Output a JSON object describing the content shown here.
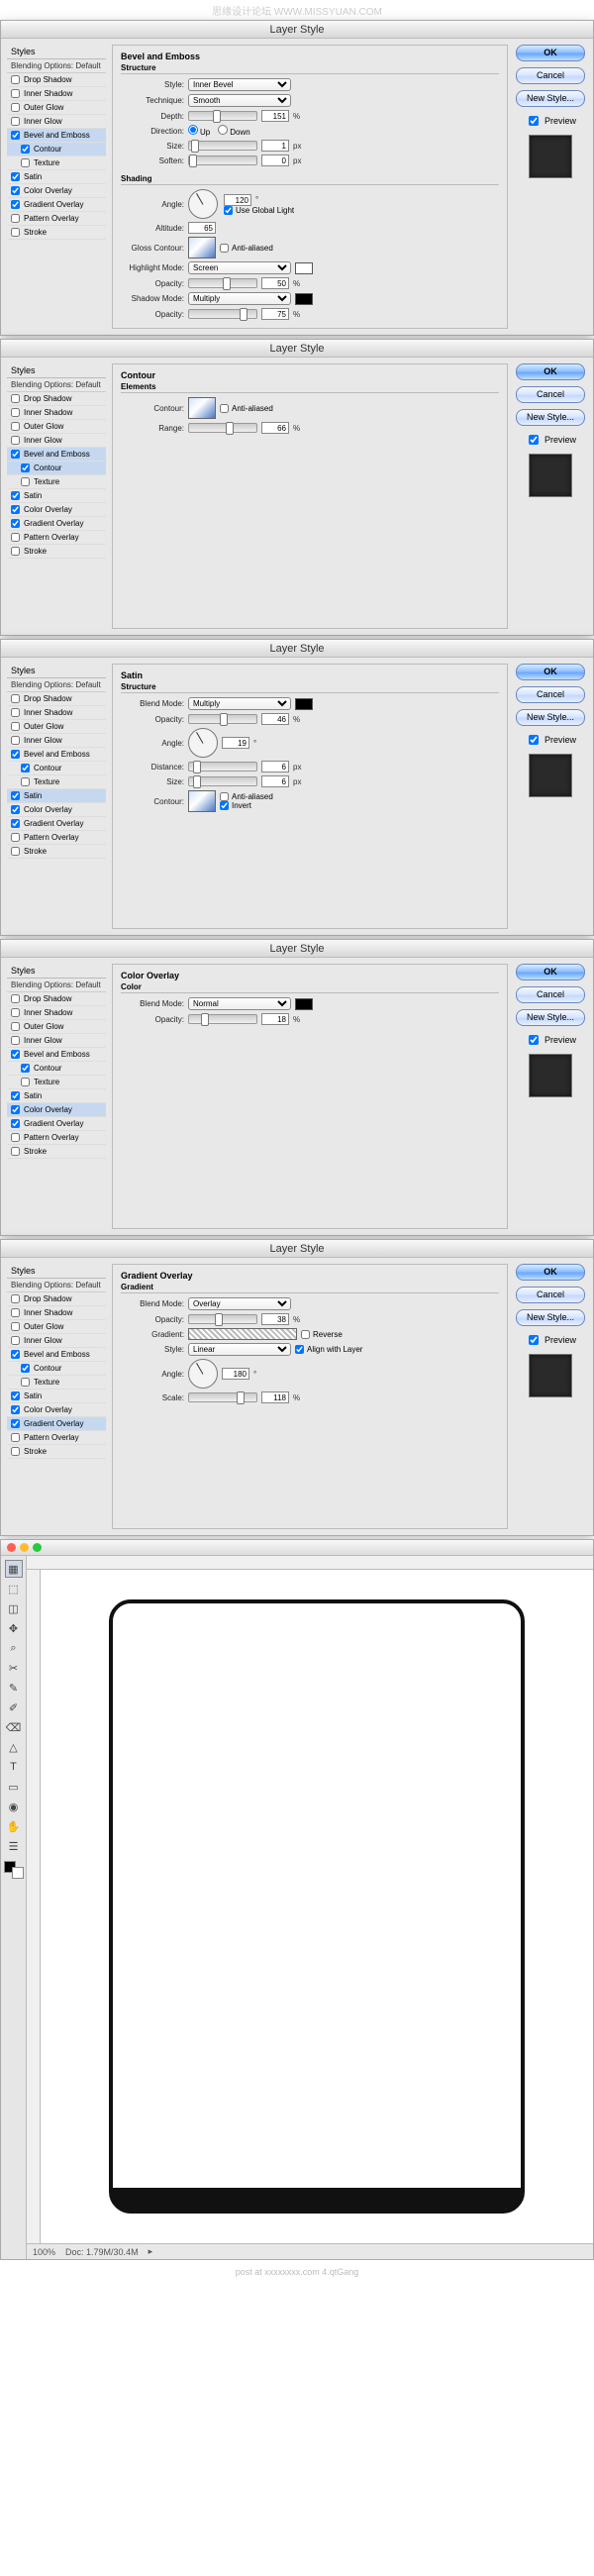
{
  "watermark": "思缘设计论坛  WWW.MISSYUAN.COM",
  "dialogs": [
    {
      "title": "Layer Style",
      "selected": "Bevel and Emboss",
      "sub_selected": "Contour",
      "styles": {
        "head": "Styles",
        "sub": "Blending Options: Default",
        "items": [
          {
            "label": "Drop Shadow",
            "ck": false,
            "indent": false
          },
          {
            "label": "Inner Shadow",
            "ck": false,
            "indent": false
          },
          {
            "label": "Outer Glow",
            "ck": false,
            "indent": false
          },
          {
            "label": "Inner Glow",
            "ck": false,
            "indent": false
          },
          {
            "label": "Bevel and Emboss",
            "ck": true,
            "indent": false,
            "sel": true
          },
          {
            "label": "Contour",
            "ck": true,
            "indent": true,
            "sel_light": true
          },
          {
            "label": "Texture",
            "ck": false,
            "indent": true
          },
          {
            "label": "Satin",
            "ck": true,
            "indent": false
          },
          {
            "label": "Color Overlay",
            "ck": true,
            "indent": false
          },
          {
            "label": "Gradient Overlay",
            "ck": true,
            "indent": false
          },
          {
            "label": "Pattern Overlay",
            "ck": false,
            "indent": false
          },
          {
            "label": "Stroke",
            "ck": false,
            "indent": false
          }
        ]
      },
      "panel": {
        "type": "bevel",
        "head": "Bevel and Emboss",
        "structure": "Structure",
        "style_l": "Style:",
        "style_v": "Inner Bevel",
        "tech_l": "Technique:",
        "tech_v": "Smooth",
        "depth_l": "Depth:",
        "depth_v": "151",
        "depth_u": "%",
        "dir_l": "Direction:",
        "dir_up": "Up",
        "dir_dn": "Down",
        "size_l": "Size:",
        "size_v": "1",
        "size_u": "px",
        "soften_l": "Soften:",
        "soften_v": "0",
        "soften_u": "px",
        "shading": "Shading",
        "ang_l": "Angle:",
        "ang_v": "120",
        "glob_l": "Use Global Light",
        "alt_l": "Altitude:",
        "alt_v": "65",
        "gc_l": "Gloss Contour:",
        "aa_l": "Anti-aliased",
        "hm_l": "Highlight Mode:",
        "hm_v": "Screen",
        "op_l": "Opacity:",
        "op1_v": "50",
        "op_u": "%",
        "sm_l": "Shadow Mode:",
        "sm_v": "Multiply",
        "op2_v": "75"
      },
      "ok": "OK",
      "cancel": "Cancel",
      "new": "New Style...",
      "preview": "Preview"
    },
    {
      "title": "Layer Style",
      "selected": "Contour",
      "styles": {
        "head": "Styles",
        "sub": "Blending Options: Default",
        "items": [
          {
            "label": "Drop Shadow",
            "ck": false
          },
          {
            "label": "Inner Shadow",
            "ck": false
          },
          {
            "label": "Outer Glow",
            "ck": false
          },
          {
            "label": "Inner Glow",
            "ck": false
          },
          {
            "label": "Bevel and Emboss",
            "ck": true,
            "sel_light": true
          },
          {
            "label": "Contour",
            "ck": true,
            "indent": true,
            "sel": true
          },
          {
            "label": "Texture",
            "ck": false,
            "indent": true
          },
          {
            "label": "Satin",
            "ck": true
          },
          {
            "label": "Color Overlay",
            "ck": true
          },
          {
            "label": "Gradient Overlay",
            "ck": true
          },
          {
            "label": "Pattern Overlay",
            "ck": false
          },
          {
            "label": "Stroke",
            "ck": false
          }
        ]
      },
      "panel": {
        "type": "contour",
        "head": "Contour",
        "elements": "Elements",
        "cont_l": "Contour:",
        "aa_l": "Anti-aliased",
        "range_l": "Range:",
        "range_v": "66",
        "range_u": "%"
      },
      "ok": "OK",
      "cancel": "Cancel",
      "new": "New Style...",
      "preview": "Preview"
    },
    {
      "title": "Layer Style",
      "selected": "Satin",
      "styles": {
        "head": "Styles",
        "sub": "Blending Options: Default",
        "items": [
          {
            "label": "Drop Shadow",
            "ck": false
          },
          {
            "label": "Inner Shadow",
            "ck": false
          },
          {
            "label": "Outer Glow",
            "ck": false
          },
          {
            "label": "Inner Glow",
            "ck": false
          },
          {
            "label": "Bevel and Emboss",
            "ck": true
          },
          {
            "label": "Contour",
            "ck": true,
            "indent": true
          },
          {
            "label": "Texture",
            "ck": false,
            "indent": true
          },
          {
            "label": "Satin",
            "ck": true,
            "sel": true
          },
          {
            "label": "Color Overlay",
            "ck": true
          },
          {
            "label": "Gradient Overlay",
            "ck": true
          },
          {
            "label": "Pattern Overlay",
            "ck": false
          },
          {
            "label": "Stroke",
            "ck": false
          }
        ]
      },
      "panel": {
        "type": "satin",
        "head": "Satin",
        "structure": "Structure",
        "bm_l": "Blend Mode:",
        "bm_v": "Multiply",
        "op_l": "Opacity:",
        "op_v": "46",
        "op_u": "%",
        "ang_l": "Angle:",
        "ang_v": "19",
        "dist_l": "Distance:",
        "dist_v": "6",
        "dist_u": "px",
        "size_l": "Size:",
        "size_v": "6",
        "size_u": "px",
        "cont_l": "Contour:",
        "aa_l": "Anti-aliased",
        "inv_l": "Invert"
      },
      "ok": "OK",
      "cancel": "Cancel",
      "new": "New Style...",
      "preview": "Preview"
    },
    {
      "title": "Layer Style",
      "selected": "Color Overlay",
      "styles": {
        "head": "Styles",
        "sub": "Blending Options: Default",
        "items": [
          {
            "label": "Drop Shadow",
            "ck": false
          },
          {
            "label": "Inner Shadow",
            "ck": false
          },
          {
            "label": "Outer Glow",
            "ck": false
          },
          {
            "label": "Inner Glow",
            "ck": false
          },
          {
            "label": "Bevel and Emboss",
            "ck": true
          },
          {
            "label": "Contour",
            "ck": true,
            "indent": true
          },
          {
            "label": "Texture",
            "ck": false,
            "indent": true
          },
          {
            "label": "Satin",
            "ck": true
          },
          {
            "label": "Color Overlay",
            "ck": true,
            "sel": true
          },
          {
            "label": "Gradient Overlay",
            "ck": true
          },
          {
            "label": "Pattern Overlay",
            "ck": false
          },
          {
            "label": "Stroke",
            "ck": false
          }
        ]
      },
      "panel": {
        "type": "coloroverlay",
        "head": "Color Overlay",
        "color": "Color",
        "bm_l": "Blend Mode:",
        "bm_v": "Normal",
        "op_l": "Opacity:",
        "op_v": "18",
        "op_u": "%"
      },
      "ok": "OK",
      "cancel": "Cancel",
      "new": "New Style...",
      "preview": "Preview"
    },
    {
      "title": "Layer Style",
      "selected": "Gradient Overlay",
      "styles": {
        "head": "Styles",
        "sub": "Blending Options: Default",
        "items": [
          {
            "label": "Drop Shadow",
            "ck": false
          },
          {
            "label": "Inner Shadow",
            "ck": false
          },
          {
            "label": "Outer Glow",
            "ck": false
          },
          {
            "label": "Inner Glow",
            "ck": false
          },
          {
            "label": "Bevel and Emboss",
            "ck": true
          },
          {
            "label": "Contour",
            "ck": true,
            "indent": true
          },
          {
            "label": "Texture",
            "ck": false,
            "indent": true
          },
          {
            "label": "Satin",
            "ck": true
          },
          {
            "label": "Color Overlay",
            "ck": true
          },
          {
            "label": "Gradient Overlay",
            "ck": true,
            "sel": true
          },
          {
            "label": "Pattern Overlay",
            "ck": false
          },
          {
            "label": "Stroke",
            "ck": false
          }
        ]
      },
      "panel": {
        "type": "gradientoverlay",
        "head": "Gradient Overlay",
        "gradient": "Gradient",
        "bm_l": "Blend Mode:",
        "bm_v": "Overlay",
        "op_l": "Opacity:",
        "op_v": "38",
        "op_u": "%",
        "grad_l": "Gradient:",
        "rev_l": "Reverse",
        "style_l": "Style:",
        "style_v": "Linear",
        "align_l": "Align with Layer",
        "ang_l": "Angle:",
        "ang_v": "180",
        "scale_l": "Scale:",
        "scale_v": "118",
        "scale_u": "%"
      },
      "ok": "OK",
      "cancel": "Cancel",
      "new": "New Style...",
      "preview": "Preview"
    }
  ],
  "ps": {
    "tools": [
      "▦",
      "⬚",
      "◫",
      "✥",
      "⌕",
      "✂",
      "✎",
      "✐",
      "⌫",
      "△",
      "T",
      "▭",
      "◉",
      "✋",
      "☰"
    ],
    "status_zoom": "100%",
    "status_doc": "Doc: 1.79M/30.4M",
    "footer": "post at xxxxxxxx.com 4.qtGang"
  }
}
